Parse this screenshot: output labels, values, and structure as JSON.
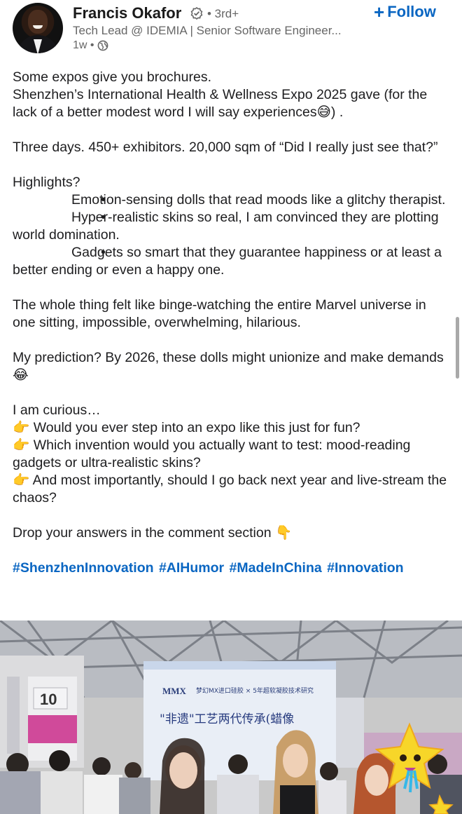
{
  "author": {
    "name": "Francis Okafor",
    "degree": "• 3rd+",
    "headline": "Tech Lead @ IDEMIA | Senior Software Engineer...",
    "time": "1w •",
    "follow_label": "Follow"
  },
  "post": {
    "intro1": "Some expos give you brochures.",
    "intro2": "Shenzhen’s International Health & Wellness Expo 2025 gave (for the lack of a better modest word I will say experiences😅) .",
    "stats": "Three days. 450+ exhibitors. 20,000 sqm of “Did I really just see that?”",
    "highlights_heading": "Highlights?",
    "bullets": [
      "Emotion-sensing dolls that read moods like a glitchy therapist.",
      "Hyper-realistic skins so real, I am convinced they are plotting world domination.",
      "Gadgets so smart that they guarantee happiness or at least a better ending or even a happy one."
    ],
    "marvel": "The whole thing felt like binge-watching the entire Marvel universe in one sitting, impossible, overwhelming, hilarious.",
    "prediction": "My prediction? By 2026, these dolls might unionize and make demands 😂",
    "curious": "I am curious…",
    "questions": [
      "👉 Would you ever step into an expo like this just for fun?",
      "👉 Which invention would you actually want to test: mood-reading gadgets or ultra-realistic skins?",
      "👉 And most importantly, should I go back next year and live-stream the chaos?"
    ],
    "cta": "Drop your answers in the comment section 👇",
    "hashtags": [
      "#ShenzhenInnovation",
      "#AIHumor",
      "#MadeInChina",
      "#Innovation"
    ]
  },
  "photo": {
    "booth_number": "10",
    "banner_brand": "MMX",
    "banner_line1": "梦幻MX进口硅胶 × 5年超软凝胶技术研究",
    "banner_line2": "\"非遗\"工艺两代传承(蜡像"
  },
  "colors": {
    "link": "#0a66c2",
    "text": "#1d1d1f",
    "muted": "#666666"
  },
  "icons": [
    "verified-icon",
    "globe-icon",
    "plus-icon",
    "sticker-star-icon"
  ]
}
